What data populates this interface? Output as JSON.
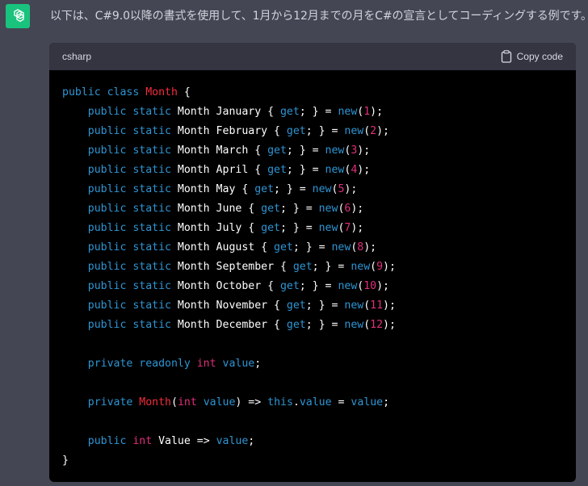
{
  "message": {
    "text": "以下は、C#9.0以降の書式を使用して、1月から12月までの月をC#の宣言としてコーディングする例です。"
  },
  "code_block": {
    "language": "csharp",
    "copy_label": "Copy code",
    "lines": [
      [
        {
          "t": "public class ",
          "c": "kw"
        },
        {
          "t": "Month",
          "c": "cls"
        },
        {
          "t": " {",
          "c": "plain"
        }
      ],
      [
        {
          "t": "    public static ",
          "c": "kw"
        },
        {
          "t": "Month January { ",
          "c": "plain"
        },
        {
          "t": "get",
          "c": "kw"
        },
        {
          "t": "; } = ",
          "c": "plain"
        },
        {
          "t": "new",
          "c": "kw"
        },
        {
          "t": "(",
          "c": "plain"
        },
        {
          "t": "1",
          "c": "num"
        },
        {
          "t": ");",
          "c": "plain"
        }
      ],
      [
        {
          "t": "    public static ",
          "c": "kw"
        },
        {
          "t": "Month February { ",
          "c": "plain"
        },
        {
          "t": "get",
          "c": "kw"
        },
        {
          "t": "; } = ",
          "c": "plain"
        },
        {
          "t": "new",
          "c": "kw"
        },
        {
          "t": "(",
          "c": "plain"
        },
        {
          "t": "2",
          "c": "num"
        },
        {
          "t": ");",
          "c": "plain"
        }
      ],
      [
        {
          "t": "    public static ",
          "c": "kw"
        },
        {
          "t": "Month March { ",
          "c": "plain"
        },
        {
          "t": "get",
          "c": "kw"
        },
        {
          "t": "; } = ",
          "c": "plain"
        },
        {
          "t": "new",
          "c": "kw"
        },
        {
          "t": "(",
          "c": "plain"
        },
        {
          "t": "3",
          "c": "num"
        },
        {
          "t": ");",
          "c": "plain"
        }
      ],
      [
        {
          "t": "    public static ",
          "c": "kw"
        },
        {
          "t": "Month April { ",
          "c": "plain"
        },
        {
          "t": "get",
          "c": "kw"
        },
        {
          "t": "; } = ",
          "c": "plain"
        },
        {
          "t": "new",
          "c": "kw"
        },
        {
          "t": "(",
          "c": "plain"
        },
        {
          "t": "4",
          "c": "num"
        },
        {
          "t": ");",
          "c": "plain"
        }
      ],
      [
        {
          "t": "    public static ",
          "c": "kw"
        },
        {
          "t": "Month May { ",
          "c": "plain"
        },
        {
          "t": "get",
          "c": "kw"
        },
        {
          "t": "; } = ",
          "c": "plain"
        },
        {
          "t": "new",
          "c": "kw"
        },
        {
          "t": "(",
          "c": "plain"
        },
        {
          "t": "5",
          "c": "num"
        },
        {
          "t": ");",
          "c": "plain"
        }
      ],
      [
        {
          "t": "    public static ",
          "c": "kw"
        },
        {
          "t": "Month June { ",
          "c": "plain"
        },
        {
          "t": "get",
          "c": "kw"
        },
        {
          "t": "; } = ",
          "c": "plain"
        },
        {
          "t": "new",
          "c": "kw"
        },
        {
          "t": "(",
          "c": "plain"
        },
        {
          "t": "6",
          "c": "num"
        },
        {
          "t": ");",
          "c": "plain"
        }
      ],
      [
        {
          "t": "    public static ",
          "c": "kw"
        },
        {
          "t": "Month July { ",
          "c": "plain"
        },
        {
          "t": "get",
          "c": "kw"
        },
        {
          "t": "; } = ",
          "c": "plain"
        },
        {
          "t": "new",
          "c": "kw"
        },
        {
          "t": "(",
          "c": "plain"
        },
        {
          "t": "7",
          "c": "num"
        },
        {
          "t": ");",
          "c": "plain"
        }
      ],
      [
        {
          "t": "    public static ",
          "c": "kw"
        },
        {
          "t": "Month August { ",
          "c": "plain"
        },
        {
          "t": "get",
          "c": "kw"
        },
        {
          "t": "; } = ",
          "c": "plain"
        },
        {
          "t": "new",
          "c": "kw"
        },
        {
          "t": "(",
          "c": "plain"
        },
        {
          "t": "8",
          "c": "num"
        },
        {
          "t": ");",
          "c": "plain"
        }
      ],
      [
        {
          "t": "    public static ",
          "c": "kw"
        },
        {
          "t": "Month September { ",
          "c": "plain"
        },
        {
          "t": "get",
          "c": "kw"
        },
        {
          "t": "; } = ",
          "c": "plain"
        },
        {
          "t": "new",
          "c": "kw"
        },
        {
          "t": "(",
          "c": "plain"
        },
        {
          "t": "9",
          "c": "num"
        },
        {
          "t": ");",
          "c": "plain"
        }
      ],
      [
        {
          "t": "    public static ",
          "c": "kw"
        },
        {
          "t": "Month October { ",
          "c": "plain"
        },
        {
          "t": "get",
          "c": "kw"
        },
        {
          "t": "; } = ",
          "c": "plain"
        },
        {
          "t": "new",
          "c": "kw"
        },
        {
          "t": "(",
          "c": "plain"
        },
        {
          "t": "10",
          "c": "num"
        },
        {
          "t": ");",
          "c": "plain"
        }
      ],
      [
        {
          "t": "    public static ",
          "c": "kw"
        },
        {
          "t": "Month November { ",
          "c": "plain"
        },
        {
          "t": "get",
          "c": "kw"
        },
        {
          "t": "; } = ",
          "c": "plain"
        },
        {
          "t": "new",
          "c": "kw"
        },
        {
          "t": "(",
          "c": "plain"
        },
        {
          "t": "11",
          "c": "num"
        },
        {
          "t": ");",
          "c": "plain"
        }
      ],
      [
        {
          "t": "    public static ",
          "c": "kw"
        },
        {
          "t": "Month December { ",
          "c": "plain"
        },
        {
          "t": "get",
          "c": "kw"
        },
        {
          "t": "; } = ",
          "c": "plain"
        },
        {
          "t": "new",
          "c": "kw"
        },
        {
          "t": "(",
          "c": "plain"
        },
        {
          "t": "12",
          "c": "num"
        },
        {
          "t": ");",
          "c": "plain"
        }
      ],
      [],
      [
        {
          "t": "    private readonly ",
          "c": "kw"
        },
        {
          "t": "int",
          "c": "num"
        },
        {
          "t": " ",
          "c": "plain"
        },
        {
          "t": "value",
          "c": "kw"
        },
        {
          "t": ";",
          "c": "plain"
        }
      ],
      [],
      [
        {
          "t": "    private ",
          "c": "kw"
        },
        {
          "t": "Month",
          "c": "cls"
        },
        {
          "t": "(",
          "c": "plain"
        },
        {
          "t": "int",
          "c": "num"
        },
        {
          "t": " ",
          "c": "plain"
        },
        {
          "t": "value",
          "c": "kw"
        },
        {
          "t": ") => ",
          "c": "plain"
        },
        {
          "t": "this",
          "c": "kw"
        },
        {
          "t": ".",
          "c": "plain"
        },
        {
          "t": "value",
          "c": "kw"
        },
        {
          "t": " = ",
          "c": "plain"
        },
        {
          "t": "value",
          "c": "kw"
        },
        {
          "t": ";",
          "c": "plain"
        }
      ],
      [],
      [
        {
          "t": "    public ",
          "c": "kw"
        },
        {
          "t": "int",
          "c": "num"
        },
        {
          "t": " Value => ",
          "c": "plain"
        },
        {
          "t": "value",
          "c": "kw"
        },
        {
          "t": ";",
          "c": "plain"
        }
      ],
      [
        {
          "t": "}",
          "c": "plain"
        }
      ]
    ]
  },
  "colors": {
    "page_bg": "#444654",
    "avatar_bg": "#19c37d",
    "code_bg": "#000000",
    "code_header_bg": "#343541",
    "keyword": "#2e95d3",
    "class_name": "#f22c3d",
    "number": "#df3079"
  },
  "icons": {
    "avatar": "openai-logo-icon",
    "copy": "clipboard-icon"
  }
}
